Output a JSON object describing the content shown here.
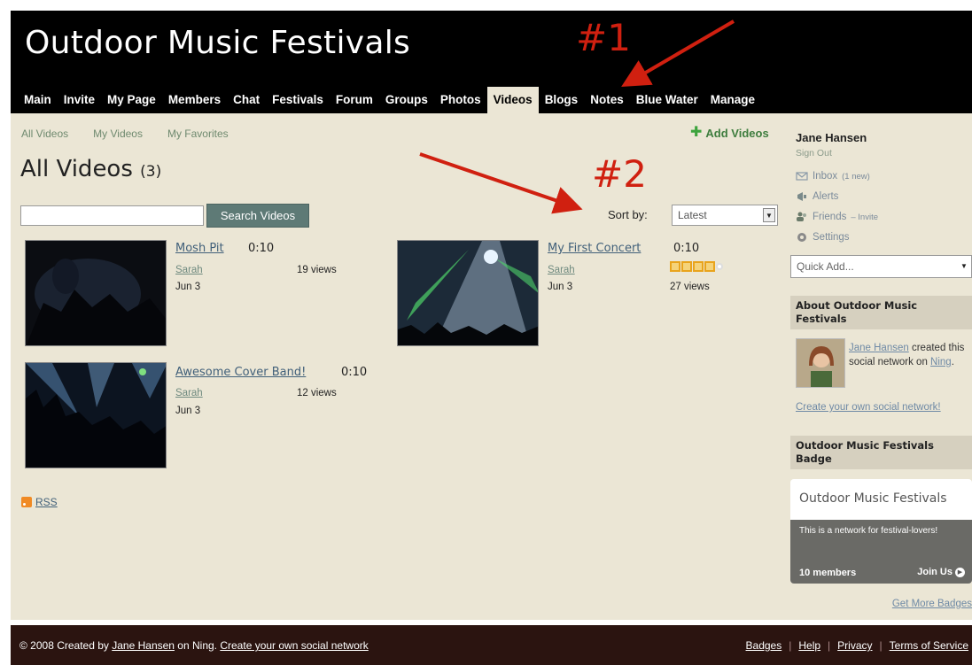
{
  "header": {
    "site_title": "Outdoor Music Festivals",
    "nav": [
      "Main",
      "Invite",
      "My Page",
      "Members",
      "Chat",
      "Festivals",
      "Forum",
      "Groups",
      "Photos",
      "Videos",
      "Blogs",
      "Notes",
      "Blue Water",
      "Manage"
    ],
    "active_nav": "Videos"
  },
  "subnav": {
    "all_videos": "All Videos",
    "my_videos": "My Videos",
    "my_favorites": "My Favorites",
    "add_videos": "Add Videos"
  },
  "main": {
    "title": "All Videos",
    "count": "(3)",
    "search_button": "Search Videos",
    "sort_label": "Sort by:",
    "sort_value": "Latest",
    "rss": "RSS"
  },
  "videos": [
    {
      "title": "Mosh Pit",
      "duration": "0:10",
      "author": "Sarah",
      "date": "Jun 3",
      "views": "19 views"
    },
    {
      "title": "My First Concert",
      "duration": "0:10",
      "author": "Sarah",
      "date": "Jun 3",
      "views": "27 views",
      "rating": 4
    },
    {
      "title": "Awesome Cover Band!",
      "duration": "0:10",
      "author": "Sarah",
      "date": "Jun 3",
      "views": "12 views"
    }
  ],
  "sidebar": {
    "user_name": "Jane Hansen",
    "sign_out": "Sign Out",
    "inbox": "Inbox",
    "inbox_note": "(1 new)",
    "alerts": "Alerts",
    "friends": "Friends",
    "friends_note": "– Invite",
    "settings": "Settings",
    "quick_add": "Quick Add...",
    "about_head": "About Outdoor Music Festivals",
    "about_owner": "Jane Hansen",
    "about_text": " created this social network on ",
    "about_platform": "Ning",
    "create_own": "Create your own social network!",
    "badge_head": "Outdoor Music Festivals Badge",
    "badge_title": "Outdoor Music Festivals",
    "badge_desc": "This is a network for festival-lovers!",
    "badge_members": "10 members",
    "badge_join": "Join Us",
    "get_more_badges": "Get More Badges"
  },
  "footer": {
    "copyright": "© 2008   Created by ",
    "owner": "Jane Hansen",
    "on_ning": " on Ning.   ",
    "create_link": "Create your own social network",
    "links": [
      "Badges",
      "Help",
      "Privacy",
      "Terms of Service"
    ]
  },
  "annotations": {
    "first": "#1",
    "second": "#2"
  },
  "colors": {
    "header_bg": "#000000",
    "content_bg": "#ebe6d5",
    "annotation_red": "#d02010",
    "footer_bg": "#2b1410"
  }
}
